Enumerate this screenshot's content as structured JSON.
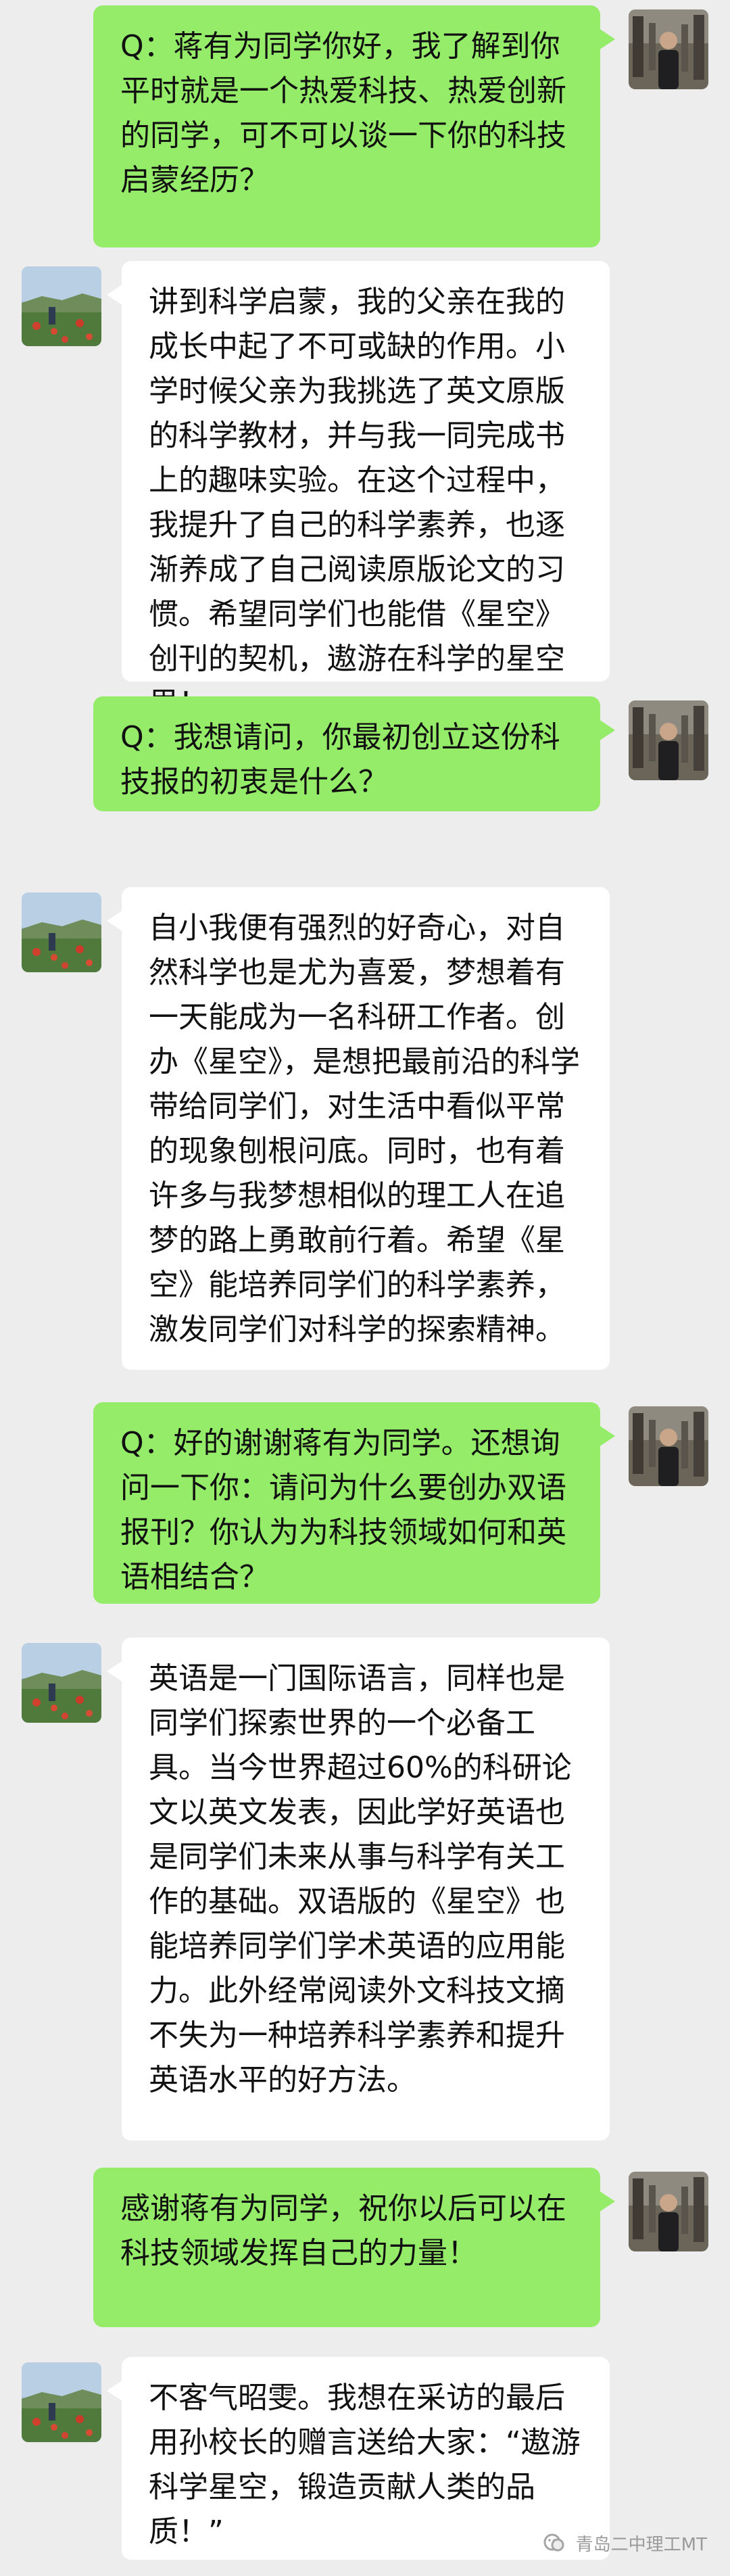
{
  "chat": {
    "messages": [
      {
        "role": "interviewer",
        "text": "Q：蒋有为同学你好，我了解到你平时就是一个热爱科技、热爱创新的同学，可不可以谈一下你的科技启蒙经历？"
      },
      {
        "role": "interviewee",
        "text": "讲到科学启蒙，我的父亲在我的成长中起了不可或缺的作用。小学时候父亲为我挑选了英文原版的科学教材，并与我一同完成书上的趣味实验。在这个过程中，我提升了自己的科学素养，也逐渐养成了自己阅读原版论文的习惯。希望同学们也能借《星空》创刊的契机，遨游在科学的星空里！"
      },
      {
        "role": "interviewer",
        "text": "Q：我想请问，你最初创立这份科技报的初衷是什么？"
      },
      {
        "role": "interviewee",
        "text": "自小我便有强烈的好奇心，对自然科学也是尤为喜爱，梦想着有一天能成为一名科研工作者。创办《星空》，是想把最前沿的科学带给同学们，对生活中看似平常的现象刨根问底。同时，也有着许多与我梦想相似的理工人在追梦的路上勇敢前行着。希望《星空》能培养同学们的科学素养，激发同学们对科学的探索精神。"
      },
      {
        "role": "interviewer",
        "text": "Q：好的谢谢蒋有为同学。还想询问一下你：请问为什么要创办双语报刊？你认为为科技领域如何和英语相结合？"
      },
      {
        "role": "interviewee",
        "text": "英语是一门国际语言，同样也是同学们探索世界的一个必备工具。当今世界超过60%的科研论文以英文发表，因此学好英语也是同学们未来从事与科学有关工作的基础。双语版的《星空》也能培养同学们学术英语的应用能力。此外经常阅读外文科技文摘不失为一种培养科学素养和提升英语水平的好方法。"
      },
      {
        "role": "interviewer",
        "text": "感谢蒋有为同学，祝你以后可以在科技领域发挥自己的力量！"
      },
      {
        "role": "interviewee",
        "text": "不客气昭雯。我想在采访的最后用孙校长的赠言送给大家：“遨游科学星空，锻造贡献人类的品质！”"
      }
    ]
  },
  "watermark": {
    "icon": "wechat-official-account-icon",
    "text": "青岛二中理工MT"
  },
  "colors": {
    "background": "#ededed",
    "interviewer_bubble": "#95ec69",
    "interviewee_bubble": "#ffffff",
    "text": "#111111"
  }
}
